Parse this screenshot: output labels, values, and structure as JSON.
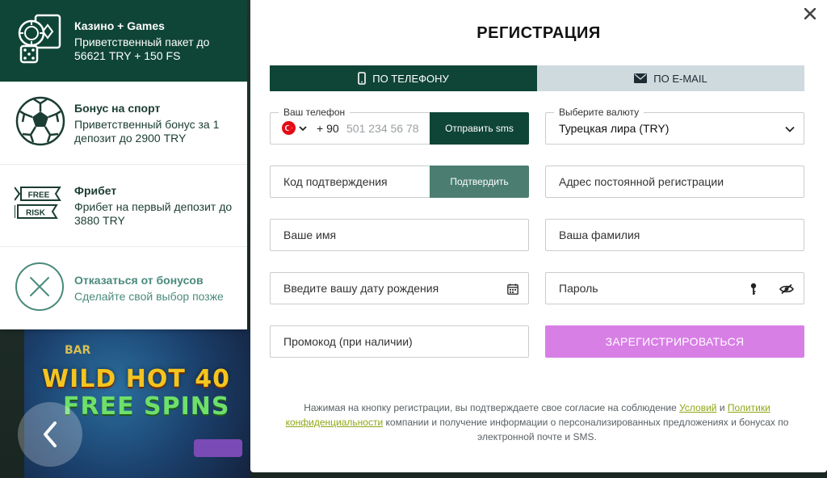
{
  "bonuses": [
    {
      "title": "Казино + Games",
      "description": "Приветственный пакет до 56621 TRY + 150 FS",
      "icon": "casino-chips-cards-icon",
      "active": true
    },
    {
      "title": "Бонус на спорт",
      "description": "Приветственный бонус за 1 депозит до 2900 TRY",
      "icon": "soccer-ball-icon",
      "active": false
    },
    {
      "title": "Фрибет",
      "description": "Фрибет на первый депозит до 3880 TRY",
      "icon": "free-risk-icon",
      "icon_text": [
        "FREE",
        "RISK"
      ],
      "active": false
    },
    {
      "title": "Отказаться от бонусов",
      "description": "Сделайте свой выбор позже",
      "icon": "decline-x-icon",
      "active": false
    }
  ],
  "banner": {
    "brand": "BAR",
    "line1": "WILD HOT 40",
    "line2": "FREE SPINS"
  },
  "modal": {
    "title": "РЕГИСТРАЦИЯ",
    "tabs": [
      {
        "label": "ПО ТЕЛЕФОНУ",
        "icon": "phone-icon",
        "active": true
      },
      {
        "label": "ПО E-MAIL",
        "icon": "envelope-icon",
        "active": false
      }
    ],
    "phone": {
      "label": "Ваш телефон",
      "country_code": "+ 90",
      "placeholder": "501 234 56 78",
      "send_button": "Отправить sms"
    },
    "currency": {
      "label": "Выберите валюту",
      "value": "Турецкая лира (TRY)"
    },
    "confirm_code": {
      "placeholder": "Код подтверждения",
      "button": "Подтвердить"
    },
    "address": {
      "placeholder": "Адрес постоянной регистрации"
    },
    "first_name": {
      "placeholder": "Ваше имя"
    },
    "last_name": {
      "placeholder": "Ваша фамилия"
    },
    "birthdate": {
      "placeholder": "Введите вашу дату рождения"
    },
    "password": {
      "placeholder": "Пароль"
    },
    "promo": {
      "placeholder": "Промокод (при наличии)"
    },
    "register_button": "ЗАРЕГИСТРИРОВАТЬСЯ",
    "consent": {
      "pre": "Нажимая на кнопку регистрации, вы подтверждаете свое согласие на соблюдение ",
      "link1": "Условий",
      "mid": " и ",
      "link2": "Политики конфиденциальности",
      "post": " компании и получение информации о персонализированных предложениях и бонусах по электронной почте и SMS."
    }
  },
  "colors": {
    "brand_dark": "#0f4536",
    "confirm_button": "#4b7e70",
    "register_button": "#d87fe6",
    "inactive_tab": "#cfdadf",
    "link": "#8ea716"
  }
}
